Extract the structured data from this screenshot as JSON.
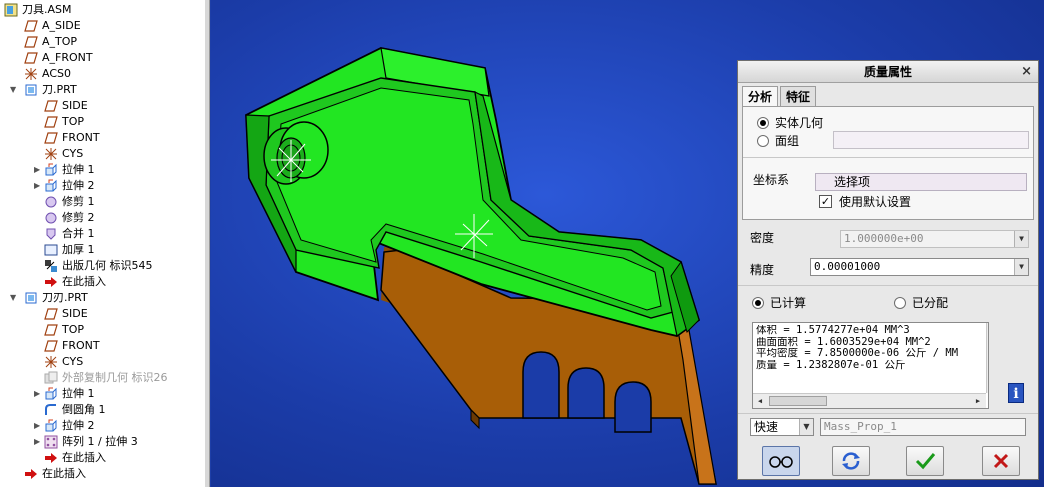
{
  "model_tree": {
    "items": [
      {
        "label": "刀具.ASM",
        "icon": "assembly-icon",
        "level": 0,
        "expander": "",
        "disabled": false
      },
      {
        "label": "A_SIDE",
        "icon": "datum-plane-icon",
        "level": 1,
        "expander": "",
        "disabled": false
      },
      {
        "label": "A_TOP",
        "icon": "datum-plane-icon",
        "level": 1,
        "expander": "",
        "disabled": false
      },
      {
        "label": "A_FRONT",
        "icon": "datum-plane-icon",
        "level": 1,
        "expander": "",
        "disabled": false
      },
      {
        "label": "ACS0",
        "icon": "csys-icon",
        "level": 1,
        "expander": "",
        "disabled": false
      },
      {
        "label": "刀.PRT",
        "icon": "part-icon",
        "level": 1,
        "expander": "▼",
        "disabled": false
      },
      {
        "label": "SIDE",
        "icon": "datum-plane-icon",
        "level": 2,
        "expander": "",
        "disabled": false
      },
      {
        "label": "TOP",
        "icon": "datum-plane-icon",
        "level": 2,
        "expander": "",
        "disabled": false
      },
      {
        "label": "FRONT",
        "icon": "datum-plane-icon",
        "level": 2,
        "expander": "",
        "disabled": false
      },
      {
        "label": "CYS",
        "icon": "csys-icon",
        "level": 2,
        "expander": "",
        "disabled": false
      },
      {
        "label": "拉伸 1",
        "icon": "extrude-icon",
        "level": 2,
        "expander": "▶",
        "disabled": false
      },
      {
        "label": "拉伸 2",
        "icon": "extrude-icon",
        "level": 2,
        "expander": "▶",
        "disabled": false
      },
      {
        "label": "修剪 1",
        "icon": "trim-icon",
        "level": 2,
        "expander": "",
        "disabled": false
      },
      {
        "label": "修剪 2",
        "icon": "trim-icon",
        "level": 2,
        "expander": "",
        "disabled": false
      },
      {
        "label": "合并 1",
        "icon": "merge-icon",
        "level": 2,
        "expander": "",
        "disabled": false
      },
      {
        "label": "加厚 1",
        "icon": "thicken-icon",
        "level": 2,
        "expander": "",
        "disabled": false
      },
      {
        "label": "出版几何 标识545",
        "icon": "publish-geom-icon",
        "level": 2,
        "expander": "",
        "disabled": false
      },
      {
        "label": "在此插入",
        "icon": "insert-here-arrow-icon",
        "level": 2,
        "expander": "",
        "disabled": false
      },
      {
        "label": "刀刃.PRT",
        "icon": "part-icon",
        "level": 1,
        "expander": "▼",
        "disabled": false
      },
      {
        "label": "SIDE",
        "icon": "datum-plane-icon",
        "level": 2,
        "expander": "",
        "disabled": false
      },
      {
        "label": "TOP",
        "icon": "datum-plane-icon",
        "level": 2,
        "expander": "",
        "disabled": false
      },
      {
        "label": "FRONT",
        "icon": "datum-plane-icon",
        "level": 2,
        "expander": "",
        "disabled": false
      },
      {
        "label": "CYS",
        "icon": "csys-icon",
        "level": 2,
        "expander": "",
        "disabled": false
      },
      {
        "label": "外部复制几何 标识26",
        "icon": "copy-geom-icon",
        "level": 2,
        "expander": "",
        "disabled": true
      },
      {
        "label": "拉伸 1",
        "icon": "extrude-icon",
        "level": 2,
        "expander": "▶",
        "disabled": false
      },
      {
        "label": "倒圆角 1",
        "icon": "round-icon",
        "level": 2,
        "expander": "",
        "disabled": false
      },
      {
        "label": "拉伸 2",
        "icon": "extrude-icon",
        "level": 2,
        "expander": "▶",
        "disabled": false
      },
      {
        "label": "阵列 1 / 拉伸 3",
        "icon": "pattern-icon",
        "level": 2,
        "expander": "▶",
        "disabled": false
      },
      {
        "label": "在此插入",
        "icon": "insert-here-arrow-icon",
        "level": 2,
        "expander": "",
        "disabled": false
      },
      {
        "label": "在此插入",
        "icon": "insert-here-arrow-icon",
        "level": 1,
        "expander": "",
        "disabled": false
      }
    ]
  },
  "dialog": {
    "title": "质量属性",
    "close_glyph": "×",
    "tabs": [
      {
        "label": "分析",
        "active": true
      },
      {
        "label": "特征",
        "active": false
      }
    ],
    "geometry_options": {
      "solid": "实体几何",
      "quilt": "面组",
      "selected": "solid"
    },
    "csys": {
      "label": "坐标系",
      "selector_text": "选择项",
      "default_checkbox_label": "使用默认设置",
      "default_checked": true
    },
    "density": {
      "label": "密度",
      "value": "1.000000e+00"
    },
    "precision": {
      "label": "精度",
      "value": "0.00001000"
    },
    "mode": {
      "computed": "已计算",
      "assigned": "已分配",
      "selected": "computed"
    },
    "results": [
      "体积 =  1.5774277e+04  MM^3",
      "曲面面积 =  1.6003529e+04  MM^2",
      "平均密度 =  7.8500000e-06 公斤 / MM",
      "质量 =  1.2382807e-01 公斤"
    ],
    "quick_mode": "快速",
    "feature_name": "Mass_Prop_1"
  },
  "colors": {
    "part_green": "#22e622",
    "part_orange": "#a85e07",
    "viewport_blue": "#1e44b8"
  }
}
